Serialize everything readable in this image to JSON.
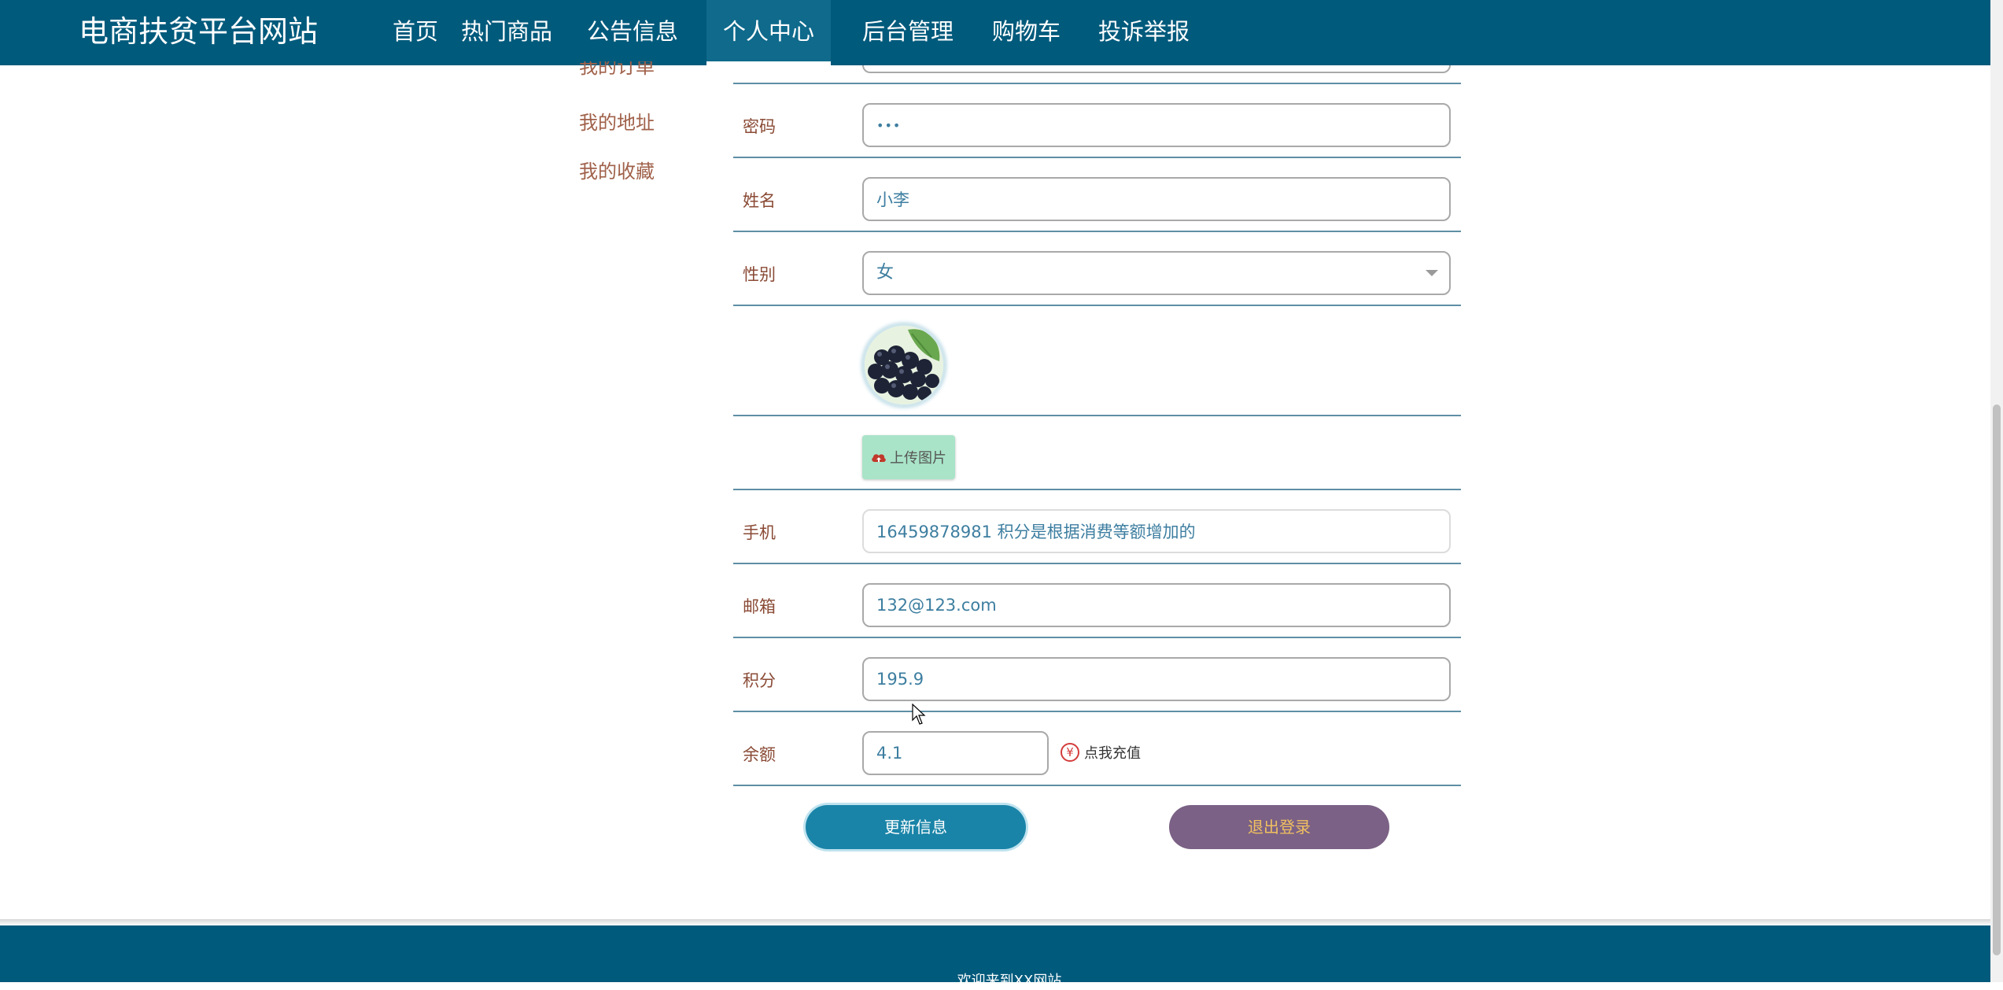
{
  "brand": "电商扶贫平台网站",
  "nav": {
    "items": [
      {
        "label": "首页"
      },
      {
        "label": "热门商品"
      },
      {
        "label": "公告信息"
      },
      {
        "label": "个人中心"
      },
      {
        "label": "后台管理"
      },
      {
        "label": "购物车"
      },
      {
        "label": "投诉举报"
      }
    ],
    "active": "个人中心"
  },
  "sidebar": {
    "items": [
      {
        "label": "我的订单"
      },
      {
        "label": "我的地址"
      },
      {
        "label": "我的收藏"
      }
    ]
  },
  "form": {
    "password": {
      "label": "密码",
      "value": "•••"
    },
    "name": {
      "label": "姓名",
      "value": "小李"
    },
    "gender": {
      "label": "性别",
      "value": "女"
    },
    "upload_label": "上传图片",
    "phone": {
      "label": "手机",
      "value": "16459878981 积分是根据消费等额增加的"
    },
    "email": {
      "label": "邮箱",
      "value": "132@123.com"
    },
    "points": {
      "label": "积分",
      "value": "195.9"
    },
    "balance": {
      "label": "余额",
      "value": "4.1"
    },
    "recharge_label": "点我充值",
    "yen_symbol": "¥"
  },
  "buttons": {
    "update": "更新信息",
    "logout": "退出登录"
  },
  "footer": {
    "text": "欢迎来到XX网站"
  },
  "colors": {
    "nav_bg": "#005a7c",
    "row_border": "#5e8fa5",
    "label_color": "#8a4a35",
    "update_button": "#1a84a8",
    "logout_button": "#7b6185",
    "upload_button": "#a9e4c8"
  }
}
